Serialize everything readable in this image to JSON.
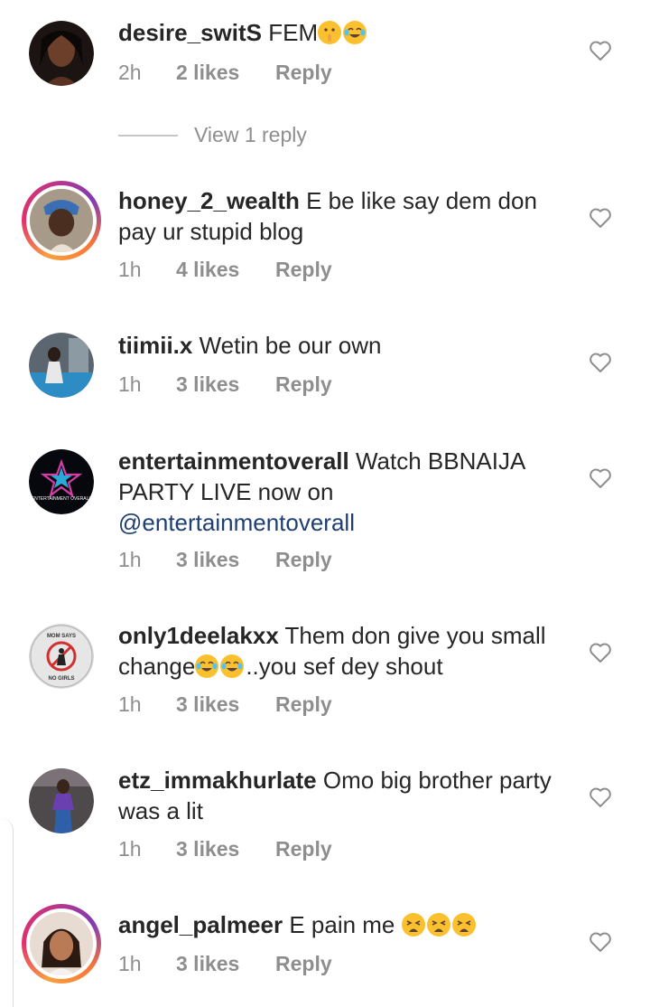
{
  "comments": [
    {
      "username": "desire_switS",
      "text": "FEM",
      "emojis": [
        "shushing-face",
        "tears-of-joy"
      ],
      "time": "2h",
      "likes": "2 likes",
      "reply": "Reply"
    },
    {
      "username": "honey_2_wealth",
      "text": "E be like say dem don pay ur stupid blog",
      "time": "1h",
      "likes": "4 likes",
      "reply": "Reply"
    },
    {
      "username": "tiimii.x",
      "text": "Wetin be our own",
      "time": "1h",
      "likes": "3 likes",
      "reply": "Reply"
    },
    {
      "username": "entertainmentoverall",
      "text": "Watch BBNAIJA PARTY LIVE now on",
      "mention": "@entertainmentoverall",
      "time": "1h",
      "likes": "3 likes",
      "reply": "Reply"
    },
    {
      "username": "only1deelakxx",
      "text_before": "Them don give you small change",
      "emojis": [
        "tears-of-joy",
        "tears-of-joy"
      ],
      "text_after": "..you sef dey shout",
      "time": "1h",
      "likes": "3 likes",
      "reply": "Reply"
    },
    {
      "username": "etz_immakhurlate",
      "text": "Omo big brother party was a lit",
      "time": "1h",
      "likes": "3 likes",
      "reply": "Reply"
    },
    {
      "username": "angel_palmeer",
      "text": "E pain me",
      "emojis": [
        "weary-face",
        "weary-face",
        "weary-face"
      ],
      "time": "1h",
      "likes": "3 likes",
      "reply": "Reply"
    }
  ],
  "view_replies": "View 1 reply",
  "avatar_text": {
    "entertainment": "ENTERTAINMENT OVERALL",
    "mom_top": "MOM SAYS",
    "mom_bottom": "NO GIRLS"
  },
  "colors": {
    "username": "#262626",
    "meta": "#8e8e8e",
    "mention": "#1e3f74",
    "emoji": "#fbc02d"
  }
}
